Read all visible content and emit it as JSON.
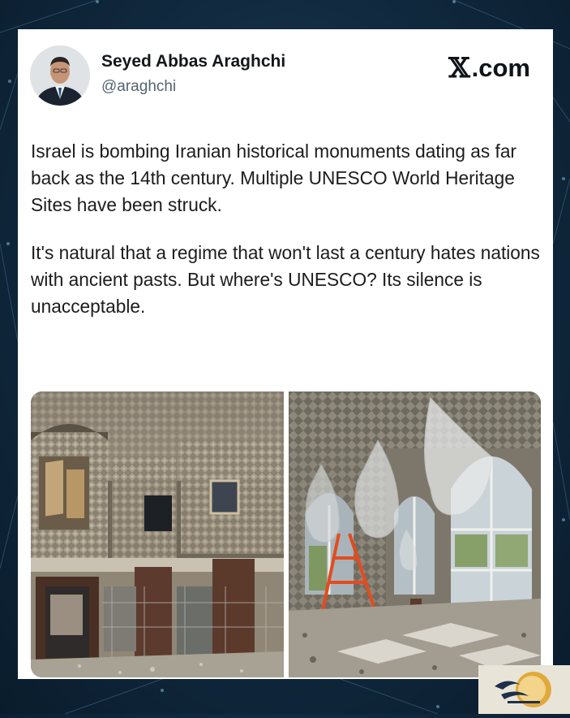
{
  "author": {
    "name": "Seyed Abbas Araghchi",
    "handle": "@araghchi"
  },
  "source_label": ".com",
  "tweet": {
    "paragraphs": [
      "Israel is bombing Iranian historical monuments dating as far back as the 14th century. Multiple UNESCO World Heritage Sites have been struck.",
      "It's natural that a regime that won't last a century hates nations with ancient pasts. But where's UNESCO? Its silence is unacceptable."
    ]
  },
  "media": {
    "images": [
      {
        "subject": "damaged mirrored hall interior with broken doors and debris"
      },
      {
        "subject": "mirrored hall with plastic-wrapped chandeliers, red ladder and debris"
      }
    ]
  },
  "watermark": {
    "name": "news-agency-logo"
  }
}
